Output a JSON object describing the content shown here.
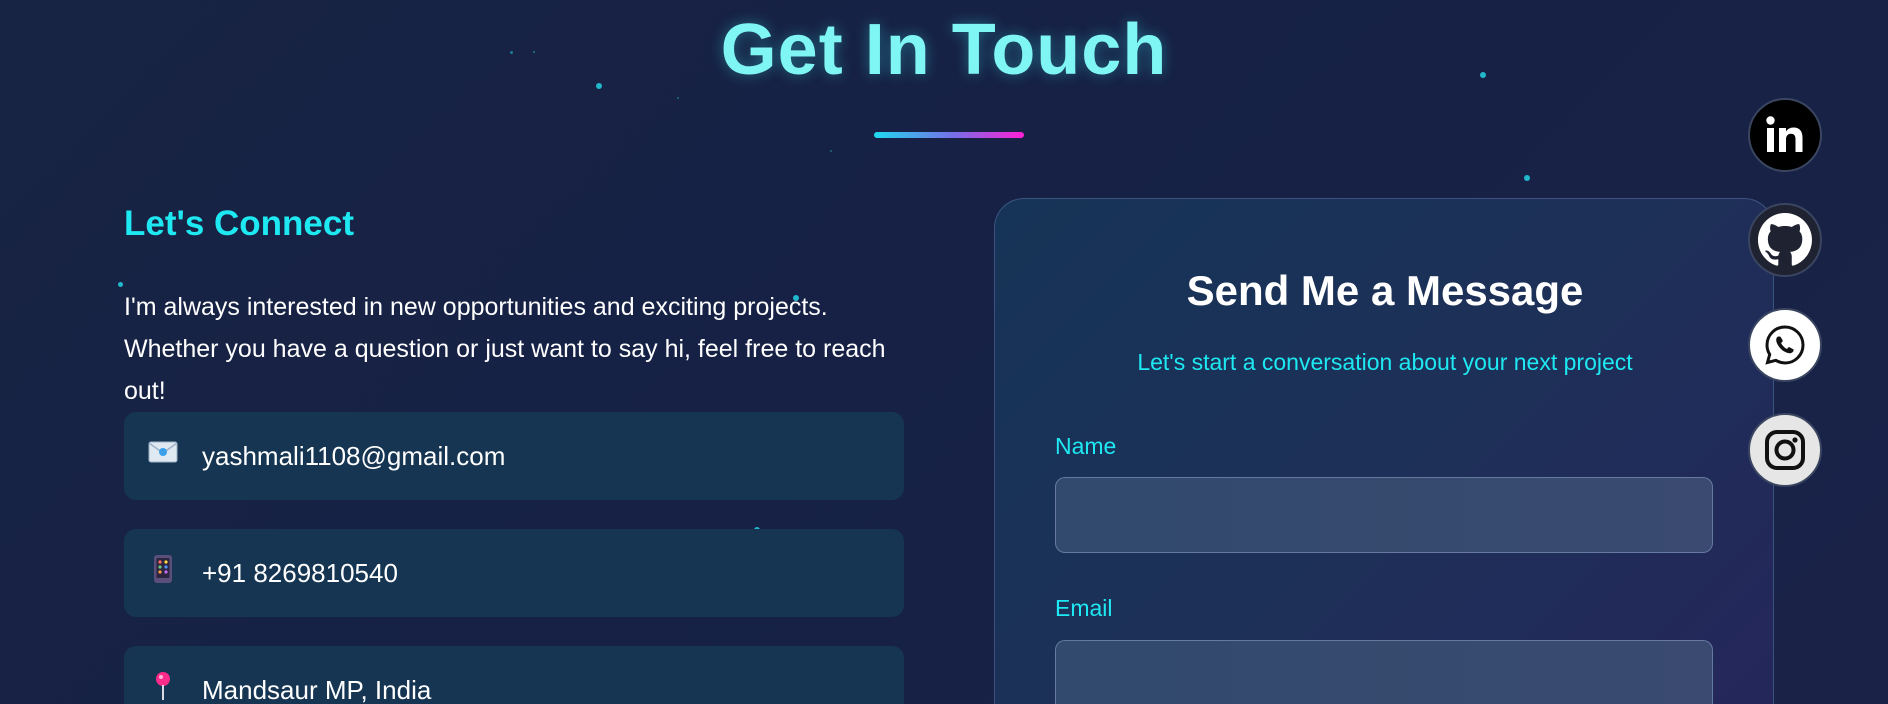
{
  "header": {
    "title": "Get In Touch"
  },
  "connect": {
    "heading": "Let's Connect",
    "text": "I'm always interested in new opportunities and exciting projects. Whether you have a question or just want to say hi, feel free to reach out!",
    "items": [
      {
        "icon": "email-icon",
        "value": "yashmali1108@gmail.com"
      },
      {
        "icon": "phone-icon",
        "value": "+91 8269810540"
      },
      {
        "icon": "location-pin-icon",
        "value": "Mandsaur MP, India"
      }
    ]
  },
  "form": {
    "title": "Send Me a Message",
    "subtitle": "Let's start a conversation about your next project",
    "name_label": "Name",
    "name_value": "",
    "email_label": "Email",
    "email_value": ""
  },
  "social": [
    "linkedin-icon",
    "github-icon",
    "whatsapp-icon",
    "instagram-icon"
  ],
  "colors": {
    "accent_cyan": "#1ee8f2",
    "title_cyan": "#7ff6f4",
    "gradient_end_pink": "#ff1fd5",
    "background": "#182444"
  }
}
